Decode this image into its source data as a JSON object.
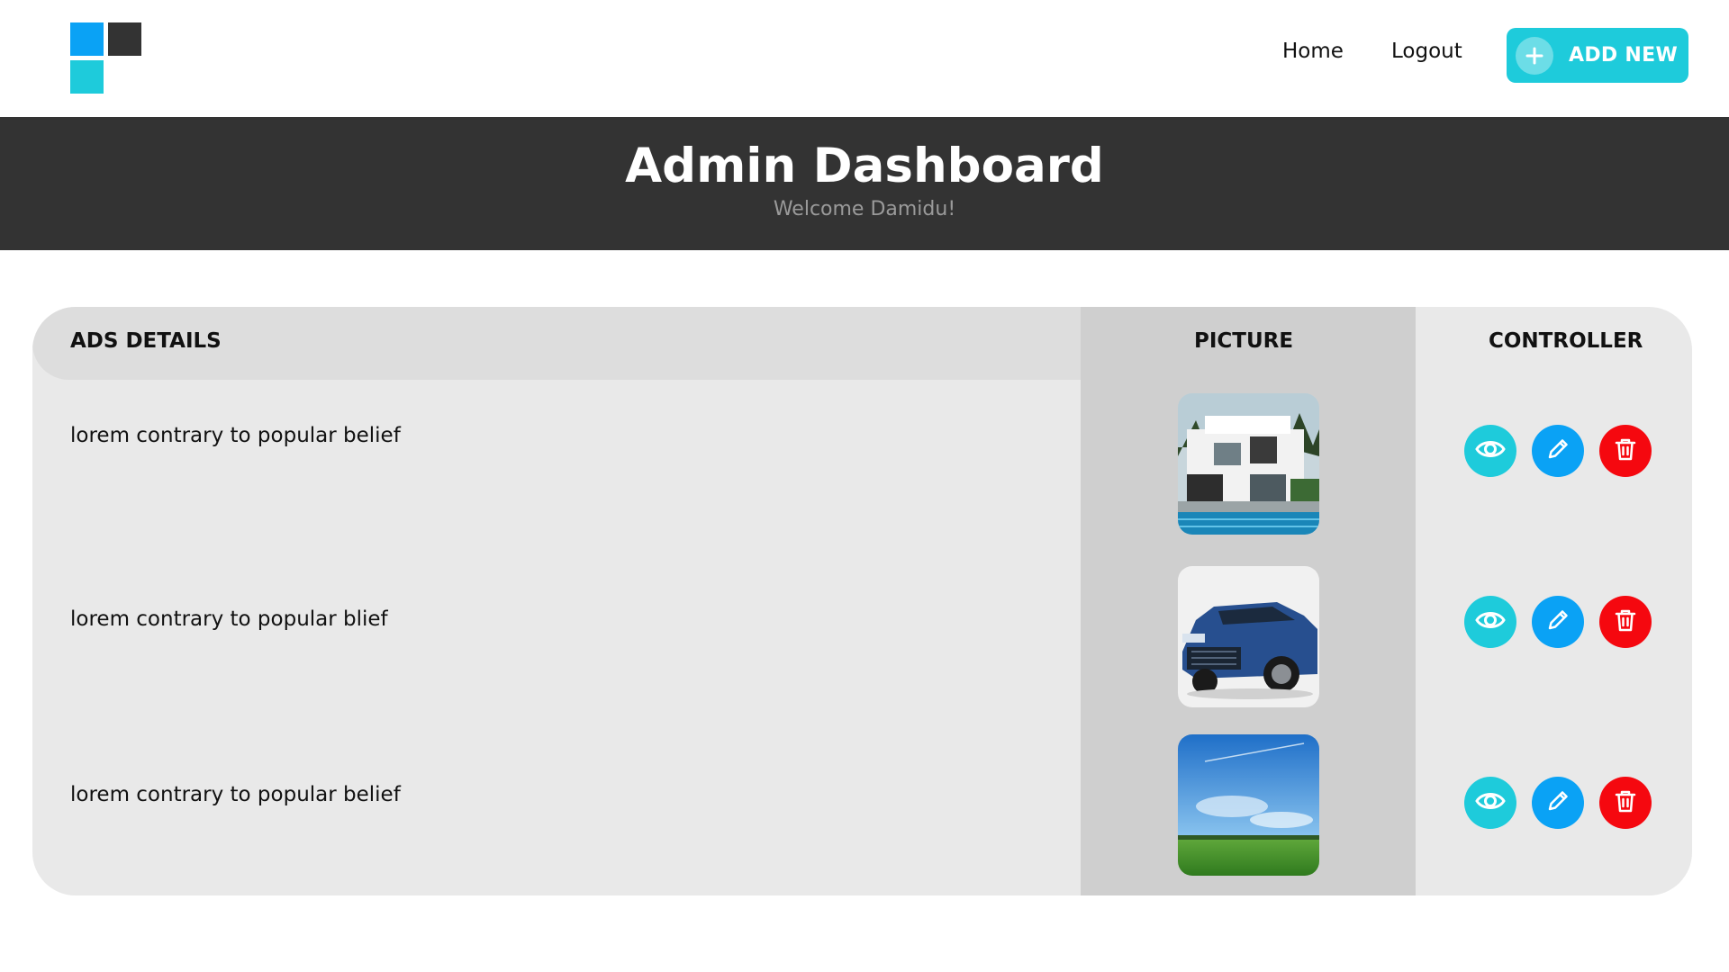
{
  "nav": {
    "home": "Home",
    "logout": "Logout",
    "add_new": "ADD NEW"
  },
  "banner": {
    "title": "Admin Dashboard",
    "welcome": "Welcome Damidu!"
  },
  "table": {
    "headers": {
      "details": "ADS DETAILS",
      "picture": "PICTURE",
      "controller": "CONTROLLER"
    },
    "rows": [
      {
        "details": "lorem contrary to popular belief",
        "picture_icon": "house-photo"
      },
      {
        "details": "lorem contrary to popular blief",
        "picture_icon": "car-photo"
      },
      {
        "details": "lorem contrary to popular belief",
        "picture_icon": "landscape-photo"
      }
    ],
    "controls": [
      "eye-icon",
      "pencil-icon",
      "trash-icon"
    ]
  },
  "colors": {
    "accent_teal": "#1ecbdb",
    "accent_blue": "#0aa2f5",
    "danger_red": "#f5080f",
    "banner_dark": "#333333",
    "table_bg": "#e9e9e9",
    "picture_col_bg": "#cfcfcf"
  }
}
